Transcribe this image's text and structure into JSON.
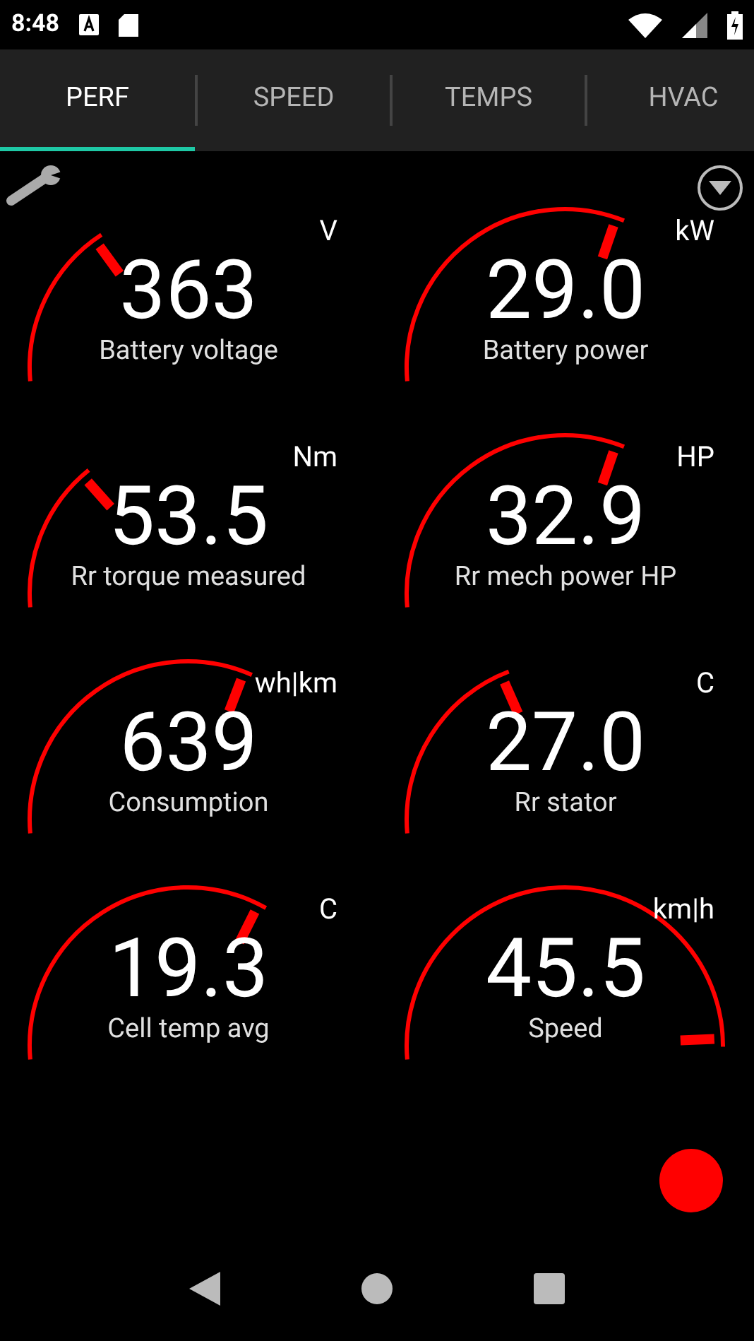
{
  "status_bar": {
    "time": "8:48"
  },
  "tabs": [
    {
      "label": "PERF",
      "selected": true
    },
    {
      "label": "SPEED",
      "selected": false
    },
    {
      "label": "TEMPS",
      "selected": false
    },
    {
      "label": "HVAC",
      "selected": false
    }
  ],
  "gauges": [
    {
      "unit": "V",
      "value": "363",
      "label": "Battery voltage"
    },
    {
      "unit": "kW",
      "value": "29.0",
      "label": "Battery power"
    },
    {
      "unit": "Nm",
      "value": "53.5",
      "label": "Rr torque measured"
    },
    {
      "unit": "HP",
      "value": "32.9",
      "label": "Rr mech power HP"
    },
    {
      "unit": "wh|km",
      "value": "639",
      "label": "Consumption"
    },
    {
      "unit": "C",
      "value": "27.0",
      "label": "Rr stator"
    },
    {
      "unit": "C",
      "value": "19.3",
      "label": "Cell temp avg"
    },
    {
      "unit": "km|h",
      "value": "45.5",
      "label": "Speed"
    }
  ]
}
